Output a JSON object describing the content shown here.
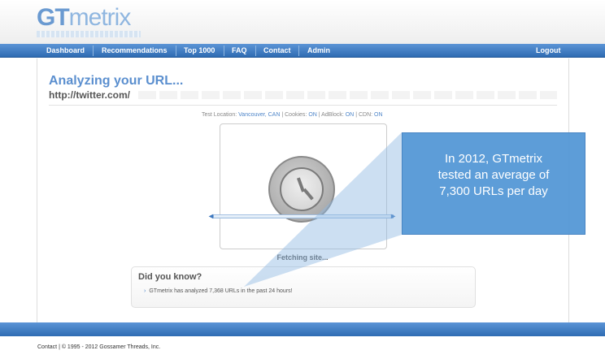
{
  "logo": {
    "gt": "GT",
    "metrix": "metrix"
  },
  "nav": {
    "items": [
      "Dashboard",
      "Recommendations",
      "Top 1000",
      "FAQ",
      "Contact",
      "Admin"
    ],
    "logout": "Logout"
  },
  "main": {
    "title": "Analyzing your URL...",
    "url": "http://twitter.com/",
    "test_info": {
      "location_label": "Test Location:",
      "location_value": "Vancouver, CAN",
      "cookies_label": "Cookies:",
      "cookies_value": "ON",
      "adblock_label": "AdBlock:",
      "adblock_value": "ON",
      "cdn_label": "CDN:",
      "cdn_value": "ON",
      "sep": "|"
    },
    "status": "Fetching site...",
    "did_you_know": {
      "title": "Did you know?",
      "arrow": "›",
      "text": "GTmetrix has analyzed 7,368 URLs in the past 24 hours!"
    }
  },
  "callout": {
    "text": "In 2012, GTmetrix\ntested an average of\n7,300 URLs per day"
  },
  "footer": {
    "text": "Contact  |  © 1995 - 2012 Gossamer Threads, Inc."
  },
  "colors": {
    "brand": "#5b8fcf",
    "nav": "#2f6cb3",
    "callout": "#5598d6"
  },
  "icons": {
    "status": "clock-icon"
  }
}
